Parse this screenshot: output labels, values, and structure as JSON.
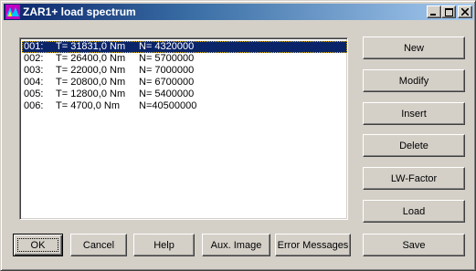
{
  "window": {
    "title": "ZAR1+ load spectrum",
    "icon": "zar-app-icon",
    "controls": [
      "minimize-icon",
      "maximize-icon",
      "close-icon"
    ]
  },
  "list": {
    "selected_index": 0,
    "items": [
      {
        "idx": "001:",
        "t": "T= 31831,0 Nm",
        "n": "N= 4320000"
      },
      {
        "idx": "002:",
        "t": "T= 26400,0 Nm",
        "n": "N= 5700000"
      },
      {
        "idx": "003:",
        "t": "T= 22000,0 Nm",
        "n": "N= 7000000"
      },
      {
        "idx": "004:",
        "t": "T= 20800,0 Nm",
        "n": "N= 6700000"
      },
      {
        "idx": "005:",
        "t": "T= 12800,0 Nm",
        "n": "N= 5400000"
      },
      {
        "idx": "006:",
        "t": "T=  4700,0 Nm",
        "n": "N=40500000"
      }
    ]
  },
  "side_buttons": {
    "new": "New",
    "modify": "Modify",
    "insert": "Insert",
    "delete": "Delete",
    "lw_factor": "LW-Factor",
    "load": "Load",
    "save": "Save"
  },
  "bottom_buttons": {
    "ok": "OK",
    "cancel": "Cancel",
    "help": "Help",
    "aux_image": "Aux. Image",
    "error_messages": "Error Messages"
  }
}
